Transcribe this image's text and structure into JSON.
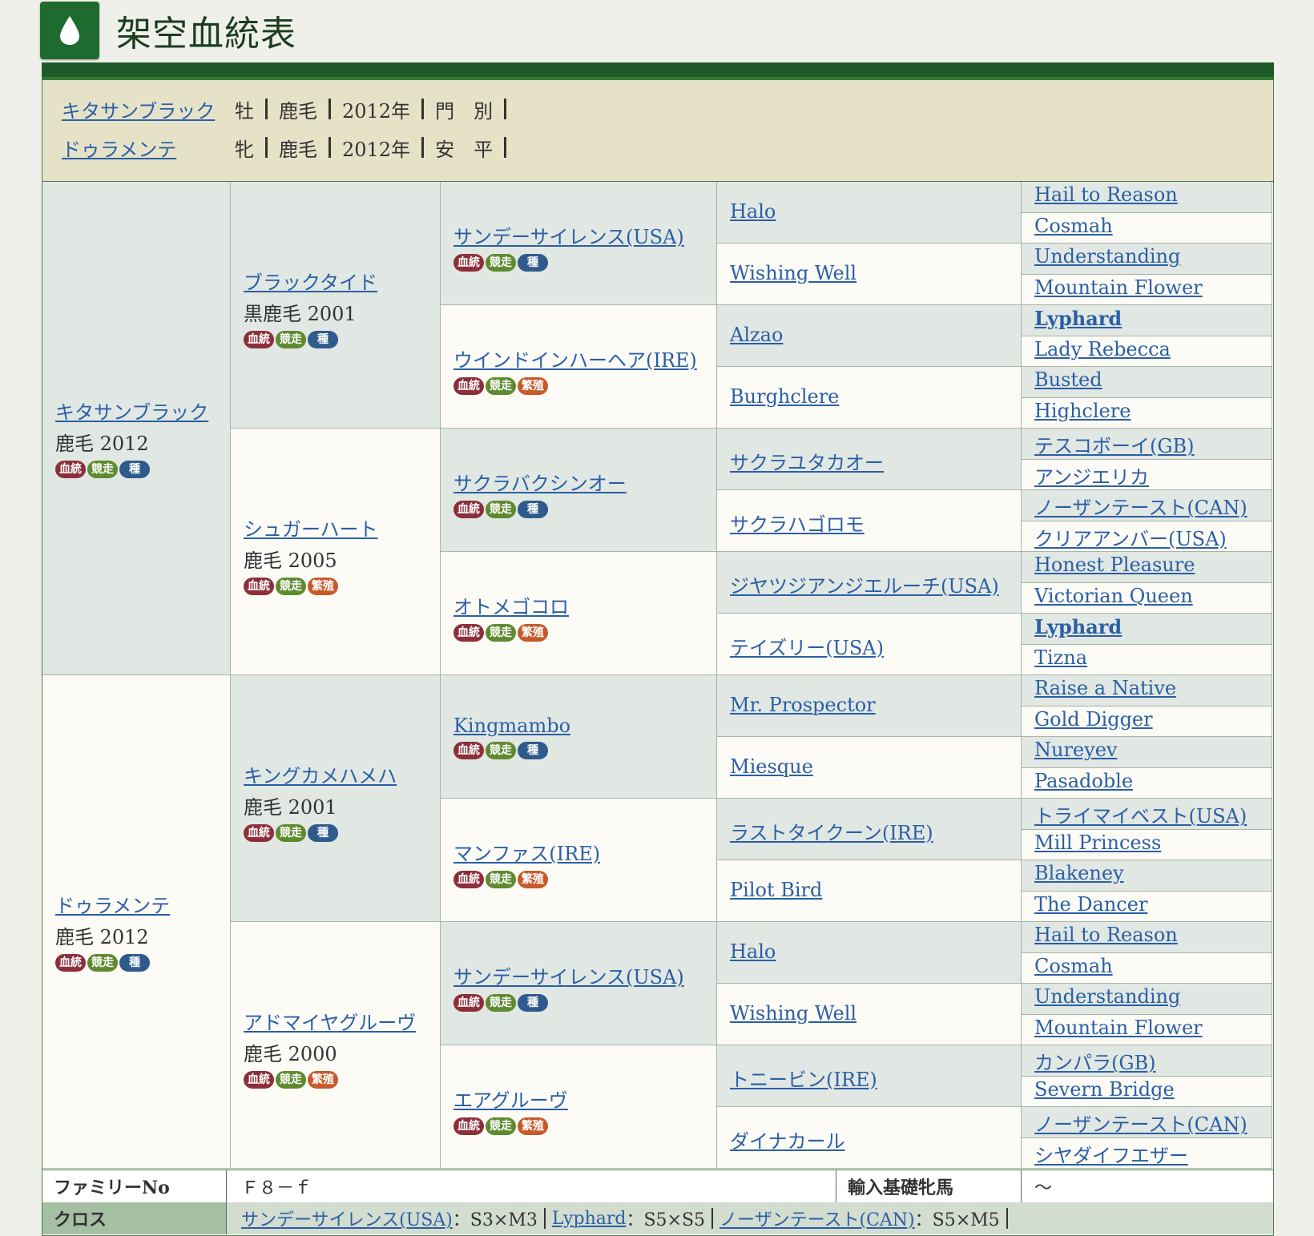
{
  "page_title": "架空血統表",
  "header": {
    "horses": [
      {
        "name": "キタサンブラック",
        "sex": "牡",
        "color": "鹿毛",
        "year": "2012年",
        "owner": "門　別"
      },
      {
        "name": "ドゥラメンテ",
        "sex": "牝",
        "color": "鹿毛",
        "year": "2012年",
        "owner": "安　平"
      }
    ]
  },
  "badges": {
    "blood": "血統",
    "race": "競走",
    "stud": "種",
    "broodmare": "繁殖"
  },
  "gen1": [
    {
      "name": "キタサンブラック",
      "detail": "鹿毛 2012"
    },
    {
      "name": "ドゥラメンテ",
      "detail": "鹿毛 2012"
    }
  ],
  "gen2": [
    {
      "name": "ブラックタイド",
      "detail": "黒鹿毛 2001"
    },
    {
      "name": "シュガーハート",
      "detail": "鹿毛 2005"
    },
    {
      "name": "キングカメハメハ",
      "detail": "鹿毛 2001"
    },
    {
      "name": "アドマイヤグルーヴ",
      "detail": "鹿毛 2000"
    }
  ],
  "gen3": [
    "サンデーサイレンス(USA)",
    "ウインドインハーヘア(IRE)",
    "サクラバクシンオー",
    "オトメゴコロ",
    "Kingmambo",
    "マンファス(IRE)",
    "サンデーサイレンス(USA)",
    "エアグルーヴ"
  ],
  "gen4": [
    "Halo",
    "Wishing Well",
    "Alzao",
    "Burghclere",
    "サクラユタカオー",
    "サクラハゴロモ",
    "ジヤツジアンジエルーチ(USA)",
    "テイズリー(USA)",
    "Mr. Prospector",
    "Miesque",
    "ラストタイクーン(IRE)",
    "Pilot Bird",
    "Halo",
    "Wishing Well",
    "トニービン(IRE)",
    "ダイナカール"
  ],
  "gen5": [
    "Hail to Reason",
    "Cosmah",
    "Understanding",
    "Mountain Flower",
    "Lyphard",
    "Lady Rebecca",
    "Busted",
    "Highclere",
    "テスコボーイ(GB)",
    "アンジエリカ",
    "ノーザンテースト(CAN)",
    "クリアアンバー(USA)",
    "Honest Pleasure",
    "Victorian Queen",
    "Lyphard",
    "Tizna",
    "Raise a Native",
    "Gold Digger",
    "Nureyev",
    "Pasadoble",
    "トライマイベスト(USA)",
    "Mill Princess",
    "Blakeney",
    "The Dancer",
    "Hail to Reason",
    "Cosmah",
    "Understanding",
    "Mountain Flower",
    "カンパラ(GB)",
    "Severn Bridge",
    "ノーザンテースト(CAN)",
    "シヤダイフエザー"
  ],
  "footer": {
    "family_label": "ファミリーNo",
    "family_value": "Ｆ８－ｆ",
    "import_label": "輸入基礎牝馬",
    "import_value": "～",
    "cross_label": "クロス",
    "cross": [
      {
        "name": "サンデーサイレンス(USA)",
        "value": "：S3×M3"
      },
      {
        "name": "Lyphard",
        "value": "：S5×S5"
      },
      {
        "name": "ノーザンテースト(CAN)",
        "value": "：S5×M5"
      }
    ]
  }
}
